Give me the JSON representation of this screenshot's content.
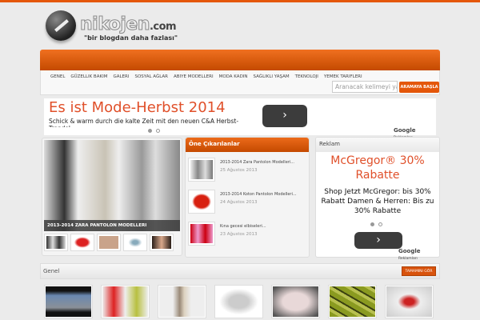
{
  "site": {
    "name": "nikojen",
    "tld": ".com",
    "slogan": "\"bir blogdan daha fazlası\""
  },
  "nav": [
    "GENEL",
    "GÜZELLIK BAKIM",
    "GALERI",
    "SOSYAL AĞLAR",
    "ABIYE MODELLERI",
    "MODA KADIN",
    "SAĞLIKLI YAŞAM",
    "TEKNOLOJI",
    "YEMEK TARIFLERI"
  ],
  "search": {
    "placeholder": "Aranacak kelimeyi yazın",
    "button": "ARAMAYA BAŞLA"
  },
  "top_ad": {
    "title": "Es ist Mode-Herbst 2014",
    "desc": "Schick & warm durch die kalte Zeit mit den neuen C&A Herbst-Trends!",
    "arrow": "›",
    "google": "Google",
    "reklam": "Reklamları"
  },
  "slider": {
    "caption": "2013-2014 ZARA PANTOLON MODELLERI"
  },
  "featured": {
    "title": "Öne Çıkarılanlar",
    "items": [
      {
        "title": "2013-2014 Zara Pantolon Modelleri...",
        "date": "25 Ağustos 2013"
      },
      {
        "title": "2013-2014 Koton Pantolon Modelleri...",
        "date": "24 Ağustos 2013"
      },
      {
        "title": "Kına gecesi elbiseleri...",
        "date": "23 Ağustos 2013"
      }
    ]
  },
  "side_ad": {
    "header": "Reklam",
    "title": "McGregor® 30% Rabatte",
    "desc": "Shop Jetzt McGregor: bis 30% Rabatt Damen & Herren: Bis zu 30% Rabatte",
    "arrow": "›",
    "google": "Google",
    "reklam": "Reklamları"
  },
  "genel": {
    "title": "Genel",
    "button": "TAMAMINI GÖR"
  },
  "colors": {
    "accent": "#e4570a",
    "ad_title": "#e0502a"
  }
}
